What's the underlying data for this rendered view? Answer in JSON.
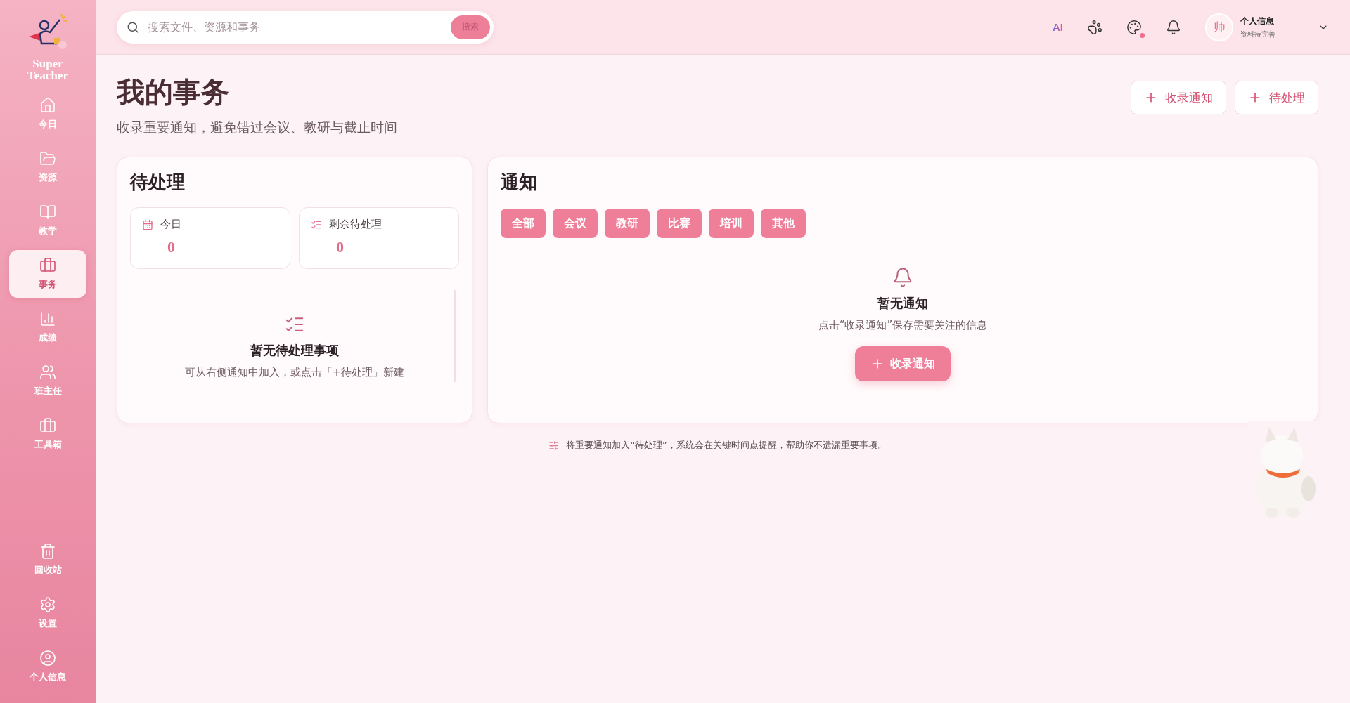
{
  "sidebar": {
    "logo_text": "Super Teacher",
    "items": [
      {
        "kind": "home",
        "label": "今日",
        "selected": false
      },
      {
        "kind": "folder",
        "label": "资源",
        "selected": false
      },
      {
        "kind": "teach",
        "label": "教学",
        "selected": false
      },
      {
        "kind": "briefcase",
        "label": "事务",
        "selected": true
      },
      {
        "kind": "chart",
        "label": "成绩",
        "selected": false
      },
      {
        "kind": "users",
        "label": "班主任",
        "selected": false
      },
      {
        "kind": "toolbox",
        "label": "工具箱",
        "selected": false
      }
    ],
    "bottom_items": [
      {
        "kind": "trash",
        "label": "回收站",
        "selected": false
      },
      {
        "kind": "settings",
        "label": "设置",
        "selected": false
      },
      {
        "kind": "user",
        "label": "个人信息",
        "selected": false
      }
    ]
  },
  "topbar": {
    "search": {
      "placeholder": "搜索文件、资源和事务",
      "button": "搜索"
    },
    "ai_label": "AI",
    "palette_dot": true,
    "user": {
      "avatar": "师",
      "name": "个人信息",
      "status": "资料待完善"
    }
  },
  "page": {
    "title": "我的事务",
    "subtitle": "收录重要通知，避免错过会议、教研与截止时间",
    "actions": [
      "收录通知",
      "待处理"
    ]
  },
  "pending": {
    "title": "待处理",
    "stats": [
      {
        "kind": "today",
        "label": "今日",
        "value": "0"
      },
      {
        "kind": "remaining",
        "label": "剩余待处理",
        "value": "0"
      }
    ],
    "empty": {
      "title": "暂无待处理事项",
      "hint": "可从右侧通知中加入，或点击「+待处理」新建"
    }
  },
  "notices": {
    "title": "通知",
    "filters": [
      "全部",
      "会议",
      "教研",
      "比赛",
      "培训",
      "其他"
    ],
    "empty": {
      "title": "暂无通知",
      "hint": "点击“收录通知”保存需要关注的信息",
      "button": "收录通知"
    }
  },
  "footer_hint": "将重要通知加入“待处理”，系统会在关键时间点提醒，帮助你不遗漏重要事项。"
}
